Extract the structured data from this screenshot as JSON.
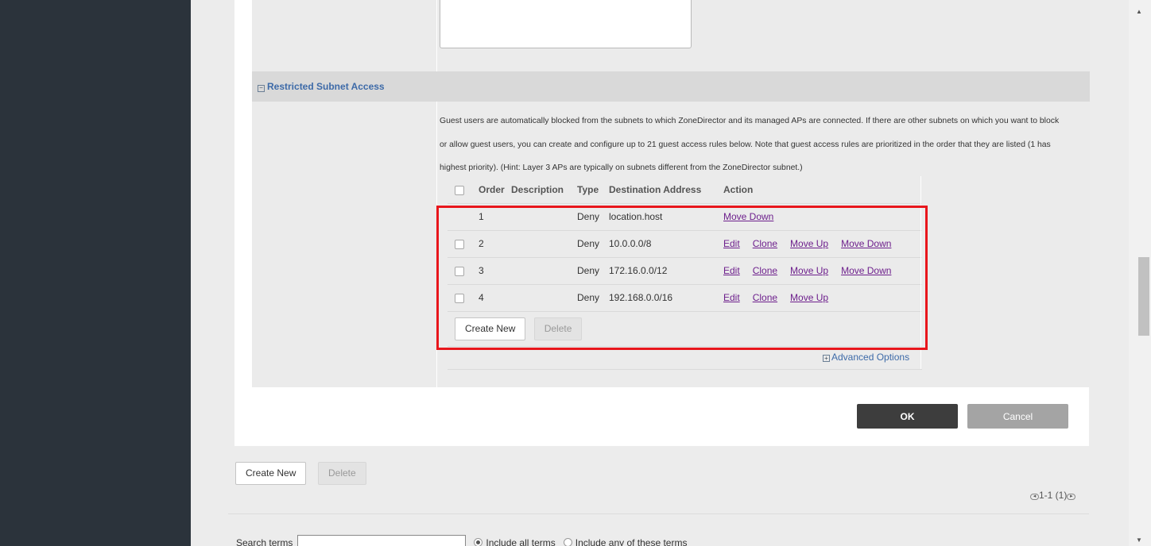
{
  "section": {
    "title": "Restricted Subnet Access",
    "collapse_glyph": "−",
    "description": "Guest users are automatically blocked from the subnets to which ZoneDirector and its managed APs are connected. If there are other subnets on which you want to block or allow guest users, you can create and configure up to 21 guest access rules below. Note that guest access rules are prioritized in the order that they are listed (1 has highest priority). (Hint: Layer 3 APs are typically on subnets different from the ZoneDirector subnet.)"
  },
  "rules_table": {
    "headers": {
      "order": "Order",
      "description": "Description",
      "type": "Type",
      "destination": "Destination Address",
      "action": "Action"
    },
    "rows": [
      {
        "order": "1",
        "description": "",
        "type": "Deny",
        "destination": "location.host",
        "has_checkbox": false,
        "actions": [
          "Move Down"
        ]
      },
      {
        "order": "2",
        "description": "",
        "type": "Deny",
        "destination": "10.0.0.0/8",
        "has_checkbox": true,
        "actions": [
          "Edit",
          "Clone",
          "Move Up",
          "Move Down"
        ]
      },
      {
        "order": "3",
        "description": "",
        "type": "Deny",
        "destination": "172.16.0.0/12",
        "has_checkbox": true,
        "actions": [
          "Edit",
          "Clone",
          "Move Up",
          "Move Down"
        ]
      },
      {
        "order": "4",
        "description": "",
        "type": "Deny",
        "destination": "192.168.0.0/16",
        "has_checkbox": true,
        "actions": [
          "Edit",
          "Clone",
          "Move Up"
        ]
      }
    ],
    "create_new_label": "Create New",
    "delete_label": "Delete"
  },
  "advanced_options": {
    "label": "Advanced Options",
    "expand_glyph": "+"
  },
  "dialog_buttons": {
    "ok": "OK",
    "cancel": "Cancel"
  },
  "outer_actions": {
    "create_new": "Create New",
    "delete": "Delete"
  },
  "pagination": {
    "text": "1-1 (1)",
    "prev_glyph": "◂",
    "next_glyph": "▸"
  },
  "search": {
    "label": "Search terms",
    "value": "",
    "include_all": "Include all terms",
    "include_any": "Include any of these terms"
  },
  "scrollbar": {
    "up_glyph": "▲",
    "down_glyph": "▼"
  },
  "colors": {
    "highlight": "#e8161c",
    "link": "#6d1f8c",
    "sidebar": "#2b333b",
    "section_title": "#3d6aa8"
  }
}
